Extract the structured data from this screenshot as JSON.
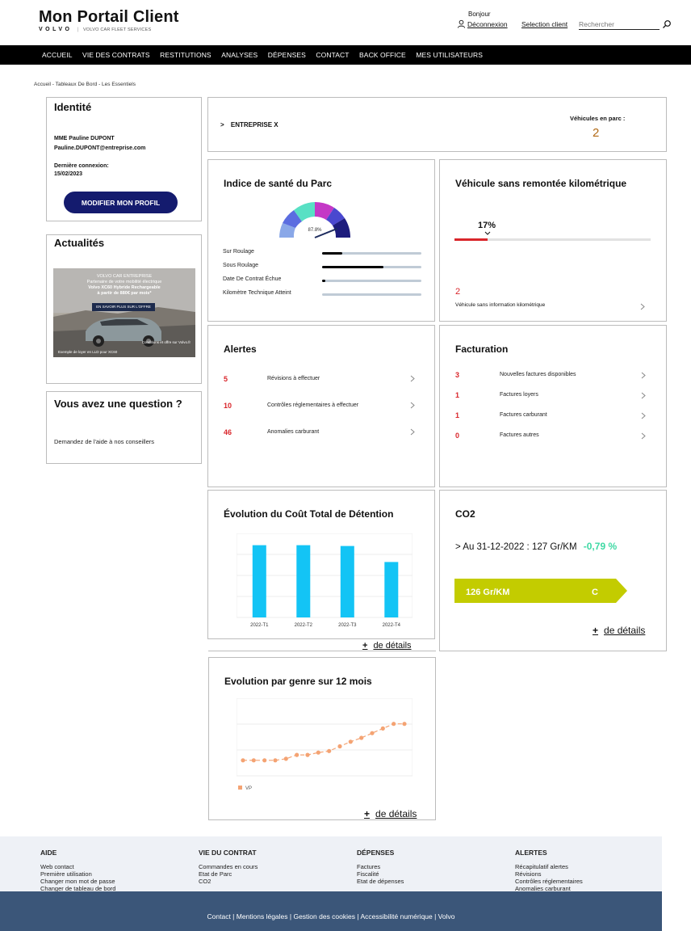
{
  "header": {
    "title": "Mon Portail Client",
    "brand": "VOLVO",
    "separator": "|",
    "service": "VOLVO CAR FLEET SERVICES",
    "greeting": "Bonjour",
    "logout": "Déconnexion",
    "select_client": "Selection client",
    "search_placeholder": "Rechercher"
  },
  "nav": [
    "ACCUEIL",
    "VIE DES CONTRATS",
    "RESTITUTIONS",
    "ANALYSES",
    "DÉPENSES",
    "CONTACT",
    "BACK OFFICE",
    "MES UTILISATEURS"
  ],
  "breadcrumb": "Accueil - Tableaux De Bord - Les Essentiels",
  "identity": {
    "title": "Identité",
    "civility": "MME",
    "name": "Pauline DUPONT",
    "email": "Pauline.DUPONT@entreprise.com",
    "last_login_label": "Dernière connexion:",
    "last_login": "15/02/2023",
    "modify_button": "MODIFIER MON PROFIL"
  },
  "news": {
    "title": "Actualités",
    "line1": "VOLVO CAR ENTREPRISE",
    "line2": "Partenaire de votre mobilité électrique",
    "line3": "Volvo XC60 Hybride Rechargeable",
    "line4": "à partir de 880€ par mois*",
    "cta": "EN SAVOIR PLUS SUR L'OFFRE",
    "footnote1": "Conditions et offre sur Volvo.fr",
    "footnote2": "Exemple de loyer en LLD pour XC60"
  },
  "question": {
    "title": "Vous avez une question ?",
    "text": "Demandez de l'aide à nos conseillers"
  },
  "company": {
    "chevron": ">",
    "name": "ENTREPRISE X",
    "vehicles_label": "Véhicules en parc :",
    "vehicles_count": "2"
  },
  "health": {
    "title": "Indice de santé du Parc",
    "gauge_value": "87.8%",
    "gauge_fraction": 0.878,
    "rows": [
      {
        "label": "Sur Roulage",
        "fill": 0.2
      },
      {
        "label": "Sous Roulage",
        "fill": 0.62
      },
      {
        "label": "Date De Contrat Échue",
        "fill": 0.03
      },
      {
        "label": "Kilomètre Technique Atteint",
        "fill": 0.0
      }
    ]
  },
  "mileage": {
    "title": "Véhicule sans remontée kilométrique",
    "percent": "17%",
    "fraction": 0.17,
    "count": "2",
    "label": "Véhicule sans information kilométrique"
  },
  "alerts": {
    "title": "Alertes",
    "items": [
      {
        "count": "5",
        "label": "Révisions à effectuer"
      },
      {
        "count": "10",
        "label": "Contrôles réglementaires à effectuer"
      },
      {
        "count": "46",
        "label": "Anomalies carburant"
      }
    ]
  },
  "billing": {
    "title": "Facturation",
    "items": [
      {
        "count": "3",
        "label": "Nouvelles factures disponibles"
      },
      {
        "count": "1",
        "label": "Factures loyers"
      },
      {
        "count": "1",
        "label": "Factures carburant"
      },
      {
        "count": "0",
        "label": "Factures autres"
      }
    ]
  },
  "tco": {
    "title": "Évolution du Coût Total de Détention",
    "details_plus": "+",
    "details": "de détails"
  },
  "co2": {
    "title": "CO2",
    "date_line": "> Au 31-12-2022 : 127 Gr/KM",
    "change": "-0,79 %",
    "badge_value": "126 Gr/KM",
    "badge_class": "C",
    "details_plus": "+",
    "details": "de détails"
  },
  "genre": {
    "title": "Evolution par genre sur 12 mois",
    "details_plus": "+",
    "details": "de détails"
  },
  "chart_data": [
    {
      "type": "bar",
      "categories": [
        "2022-T1",
        "2022-T2",
        "2022-T3",
        "2022-T4"
      ],
      "values": [
        86,
        86,
        85,
        66
      ],
      "ylim": [
        0,
        100
      ],
      "grid": true,
      "color": "#13c4f5"
    },
    {
      "type": "line",
      "x": [
        1,
        2,
        3,
        4,
        5,
        6,
        7,
        8,
        9,
        10,
        11,
        12,
        13,
        14,
        15,
        16
      ],
      "series": [
        {
          "name": "VP",
          "values": [
            20,
            20,
            20,
            20,
            22,
            27,
            27,
            30,
            32,
            38,
            44,
            49,
            55,
            61,
            67,
            67
          ]
        }
      ],
      "ylim": [
        0,
        100
      ],
      "grid": true,
      "color": "#f4a373",
      "legend": "bottom-left"
    }
  ],
  "footer": {
    "cols": [
      {
        "title": "AIDE",
        "items": [
          "Web contact",
          "Première utilisation",
          "Changer mon mot de passe",
          "Changer de tableau de bord"
        ]
      },
      {
        "title": "VIE DU CONTRAT",
        "items": [
          "Commandes en cours",
          "Etat de Parc",
          "CO2"
        ]
      },
      {
        "title": "DÉPENSES",
        "items": [
          "Factures",
          "Fiscalité",
          "Etat de dépenses"
        ]
      },
      {
        "title": "ALERTES",
        "items": [
          "Récapitulatif alertes",
          "Révisions",
          "Contrôles réglementaires",
          "Anomalies carburant"
        ]
      }
    ],
    "bottom": "Contact  |  Mentions légales  |  Gestion des cookies  |  Accessibilité numérique  |  Volvo"
  }
}
